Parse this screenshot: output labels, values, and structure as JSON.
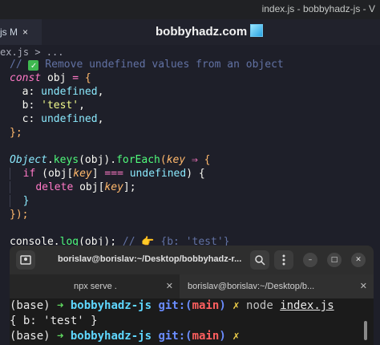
{
  "window": {
    "title": "index.js - bobbyhadz-js - V"
  },
  "editor_tab": {
    "label": "js M",
    "close": "×"
  },
  "brand": {
    "text": "bobbyhadz.com"
  },
  "breadcrumb": "ex.js > ...",
  "code": {
    "l1_comment_prefix": "// ",
    "l1_check": "✓",
    "l1_comment": " Remove undefined values from an object",
    "l2_const": "const",
    "l2_obj": " obj ",
    "l2_eq": "=",
    "l2_brace": " {",
    "l3_key": "  a: ",
    "l3_val": "undefined",
    "l3_end": ",",
    "l4_key": "  b: ",
    "l4_val": "'test'",
    "l4_end": ",",
    "l5_key": "  c: ",
    "l5_val": "undefined",
    "l5_end": ",",
    "l6": "};",
    "l8_object": "Object",
    "l8_dot1": ".",
    "l8_keys": "keys",
    "l8_args": "(obj).",
    "l8_foreach": "forEach",
    "l8_open": "(",
    "l8_param": "key",
    "l8_arrow": " ⇒ ",
    "l8_brace": "{",
    "l9_if": "if",
    "l9_open": " (obj[",
    "l9_key": "key",
    "l9_mid": "] ",
    "l9_op": "===",
    "l9_undef": " undefined",
    "l9_close": ") {",
    "l10_delete": "delete",
    "l10_obj": " obj[",
    "l10_key": "key",
    "l10_end": "];",
    "l11": "}",
    "l12": "});",
    "l14_console": "console.",
    "l14_log": "log",
    "l14_args": "(obj); ",
    "l14_comment": "// 👉 {b: 'test'}"
  },
  "terminal": {
    "title": "borislav@borislav:~/Desktop/bobbyhadz-r...",
    "tabs": [
      {
        "label": "npx serve ."
      },
      {
        "label": "borislav@borislav:~/Desktop/b..."
      }
    ],
    "lines": {
      "base": "(base) ",
      "arrow": "➜ ",
      "repo": "bobbyhadz-js ",
      "git": "git:(",
      "branch": "main",
      "git_close": ") ",
      "dirty": "✗ ",
      "cmd": "node ",
      "file": "index.js",
      "output": "{ b: 'test' }"
    }
  }
}
